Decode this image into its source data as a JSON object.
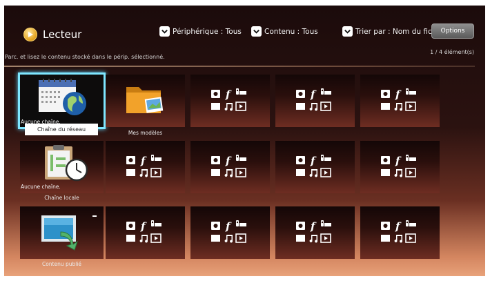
{
  "header": {
    "title": "Lecteur",
    "filters": [
      {
        "label": "Périphérique : Tous"
      },
      {
        "label": "Contenu : Tous"
      },
      {
        "label": "Trier par : Nom du fichier"
      }
    ],
    "options_label": "Options"
  },
  "info": {
    "subtitle": "Parc. et lisez le contenu stocké dans le périp. sélectionné.",
    "count": "1 / 4 élément(s)"
  },
  "tiles": {
    "network_channel": {
      "label": "Chaîne du réseau",
      "status": "Aucune chaîne."
    },
    "my_templates": {
      "label": "Mes modèles"
    },
    "local_channel": {
      "label": "Chaîne locale",
      "status": "Aucune chaîne."
    },
    "published_content": {
      "label": "Contenu publié"
    }
  },
  "colors": {
    "selection": "#7ee6ff",
    "accent_logo": "#e6a522",
    "folder": "#f2a22a"
  },
  "icons": [
    "player-logo-icon",
    "chevron-down-icon",
    "calendar-globe-icon",
    "folder-image-icon",
    "clipboard-clock-icon",
    "published-content-icon",
    "photo-icon",
    "music-icon",
    "video-icon"
  ]
}
